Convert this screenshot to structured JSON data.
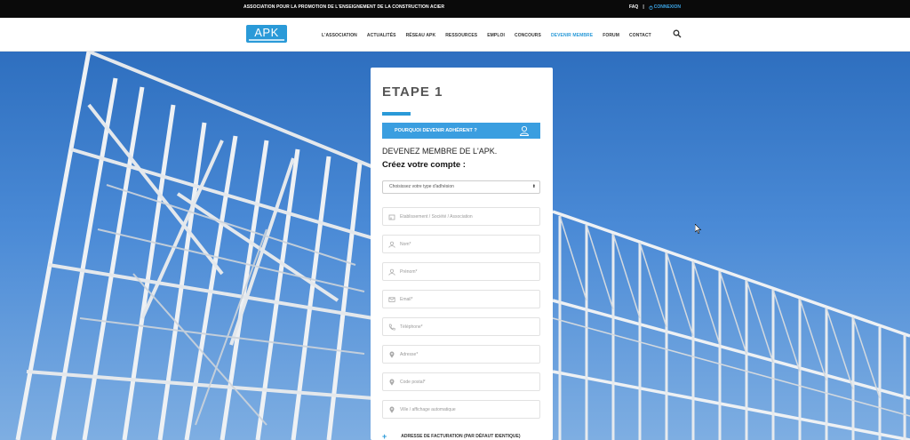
{
  "topbar": {
    "tagline": "ASSOCIATION POUR LA PROMOTION DE L'ENSEIGNEMENT DE LA CONSTRUCTION ACIER",
    "faq": "FAQ",
    "separator": "|",
    "login": "CONNEXION"
  },
  "header": {
    "logo": "APK",
    "nav": [
      "L'ASSOCIATION",
      "ACTUALITÉS",
      "RÉSEAU APK",
      "RESSOURCES",
      "EMPLOI",
      "CONCOURS",
      "DEVENIR MEMBRE",
      "FORUM",
      "CONTACT"
    ],
    "active_nav": "DEVENIR MEMBRE"
  },
  "form": {
    "step_title": "ETAPE 1",
    "why_button": "POURQUOI DEVENIR ADHÉRENT ?",
    "become_text": "DEVENEZ MEMBRE DE L'APK.",
    "create_text": "Créez votre compte :",
    "membership_select": "Choisissez votre type d'adhésion",
    "fields": {
      "company": "Établissement / Société / Association",
      "lastname": "Nom*",
      "firstname": "Prénom*",
      "email": "Email*",
      "phone": "Téléphone*",
      "address": "Adresse*",
      "postcode": "Code postal*",
      "city": "Ville / affichage automatique"
    },
    "billing": "ADRESSE DE FACTURATION (PAR DÉFAUT IDENTIQUE)"
  },
  "colors": {
    "accent": "#2a9ad8",
    "button": "#3a9ee0",
    "topbar": "#0a0a0a"
  }
}
